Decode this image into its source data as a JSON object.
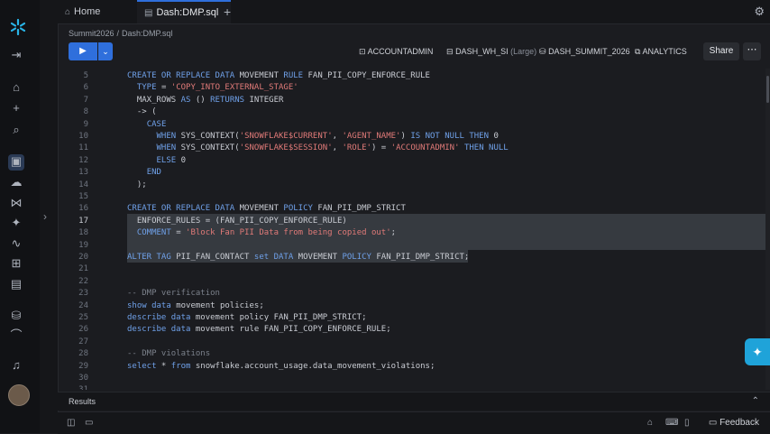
{
  "tabs": [
    {
      "label": "Home",
      "icon": "home-icon"
    },
    {
      "label": "Dash:DMP.sql",
      "icon": "sql-file-icon"
    }
  ],
  "breadcrumb": {
    "parent": "Summit2026",
    "current": "Dash:DMP.sql"
  },
  "context": {
    "role": "ACCOUNTADMIN",
    "warehouse": "DASH_WH_SI",
    "warehouse_size": "(Large)",
    "database": "DASH_SUMMIT_2026",
    "schema": "ANALYTICS"
  },
  "toolbar": {
    "share_label": "Share",
    "more_label": "⋯"
  },
  "editor": {
    "lines": [
      {
        "n": "5",
        "html": "<span class=\"kw\">CREATE OR REPLACE DATA</span> MOVEMENT <span class=\"kw\">RULE</span> FAN_PII_COPY_ENFORCE_RULE"
      },
      {
        "n": "6",
        "html": "  <span class=\"kw\">TYPE</span> = <span class=\"str\">'COPY_INTO_EXTERNAL_STAGE'</span>"
      },
      {
        "n": "7",
        "html": "  MAX_ROWS <span class=\"kw\">AS</span> () <span class=\"kw\">RETURNS</span> INTEGER"
      },
      {
        "n": "8",
        "html": "  -> ("
      },
      {
        "n": "9",
        "html": "    <span class=\"kw\">CASE</span>"
      },
      {
        "n": "10",
        "html": "      <span class=\"kw\">WHEN</span> SYS_CONTEXT(<span class=\"str\">'SNOWFLAKE$CURRENT'</span>, <span class=\"str\">'AGENT_NAME'</span>) <span class=\"kw\">IS NOT NULL THEN</span> 0"
      },
      {
        "n": "11",
        "html": "      <span class=\"kw\">WHEN</span> SYS_CONTEXT(<span class=\"str\">'SNOWFLAKE$SESSION'</span>, <span class=\"str\">'ROLE'</span>) = <span class=\"str\">'ACCOUNTADMIN'</span> <span class=\"kw\">THEN NULL</span>"
      },
      {
        "n": "12",
        "html": "      <span class=\"kw\">ELSE</span> 0"
      },
      {
        "n": "13",
        "html": "    <span class=\"kw\">END</span>"
      },
      {
        "n": "14",
        "html": "  );"
      },
      {
        "n": "15",
        "html": ""
      },
      {
        "n": "16",
        "html": "<span class=\"kw\">CREATE OR REPLACE DATA</span> MOVEMENT <span class=\"kw\">POLICY</span> FAN_PII_DMP_STRICT"
      },
      {
        "n": "17",
        "html": "  ENFORCE_RULES = (FAN_PII_COPY_ENFORCE_RULE)"
      },
      {
        "n": "18",
        "html": "  <span class=\"kw\">COMMENT</span> = <span class=\"str\">'Block Fan PII Data from being copied out'</span>;"
      },
      {
        "n": "19",
        "html": ""
      },
      {
        "n": "20",
        "html": "<span class=\"kw\">ALTER TAG</span> PII_FAN_CONTACT <span class=\"kw\">set DATA</span> MOVEMENT <span class=\"kw\">POLICY</span> FAN_PII_DMP_STRICT;"
      },
      {
        "n": "21",
        "html": ""
      },
      {
        "n": "22",
        "html": ""
      },
      {
        "n": "23",
        "html": "<span class=\"cmt\">-- DMP verification</span>"
      },
      {
        "n": "24",
        "html": "<span class=\"kw\">show data</span> movement policies;"
      },
      {
        "n": "25",
        "html": "<span class=\"kw\">describe data</span> movement policy FAN_PII_DMP_STRICT;"
      },
      {
        "n": "26",
        "html": "<span class=\"kw\">describe data</span> movement rule FAN_PII_COPY_ENFORCE_RULE;"
      },
      {
        "n": "27",
        "html": ""
      },
      {
        "n": "28",
        "html": "<span class=\"cmt\">-- DMP violations</span>"
      },
      {
        "n": "29",
        "html": "<span class=\"kw\">select</span> * <span class=\"kw\">from</span> snowflake.account_usage.data_movement_violations;"
      },
      {
        "n": "30",
        "html": ""
      },
      {
        "n": "31",
        "html": ""
      }
    ]
  },
  "results": {
    "label": "Results"
  },
  "statusbar": {
    "feedback_label": "Feedback"
  },
  "colors": {
    "accent": "#2f6fdc",
    "assistant": "#1fa3d9",
    "keyword": "#6fa0e8",
    "string": "#e07a78"
  }
}
